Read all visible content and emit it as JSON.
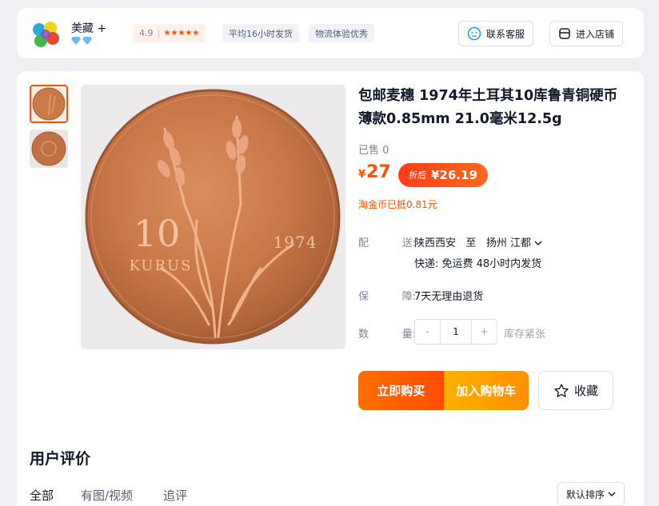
{
  "shop": {
    "name": "美藏",
    "plus": "+",
    "rating": "4.9",
    "stars": "★★★★★",
    "tags": [
      "平均16小时发货",
      "物流体验优秀"
    ],
    "buttons": {
      "service": "联系客服",
      "enter_store": "进入店铺"
    }
  },
  "product": {
    "title": "包邮麦穗 1974年土耳其10库鲁青铜硬币 薄款0.85mm 21.0毫米12.5g",
    "sold": "已售 0",
    "price_symbol": "¥",
    "price": "27",
    "coupon_label": "折后",
    "coupon_price": "¥26.19",
    "taojin": "淘金币已抵0.81元",
    "coin_value": "10",
    "coin_unit": "KURUS",
    "coin_year": "1974"
  },
  "delivery": {
    "label_a": "配",
    "label_b": "送:",
    "from": "陕西西安",
    "to_word": "至",
    "dest": "扬州 江都",
    "express": "快递: 免运费  48小时内发货"
  },
  "guarantee": {
    "label_a": "保",
    "label_b": "障:",
    "value": "7天无理由退货"
  },
  "quantity": {
    "label_a": "数",
    "label_b": "量:",
    "minus": "-",
    "value": "1",
    "plus": "+",
    "stock": "库存紧张"
  },
  "actions": {
    "buy_now": "立即购买",
    "add_cart": "加入购物车",
    "favorite": "收藏"
  },
  "reviews": {
    "title": "用户评价",
    "tabs": [
      "全部",
      "有图/视频",
      "追评"
    ],
    "sort": "默认排序"
  },
  "colors": {
    "accent": "#ff5000",
    "cart": "#ffa000"
  }
}
